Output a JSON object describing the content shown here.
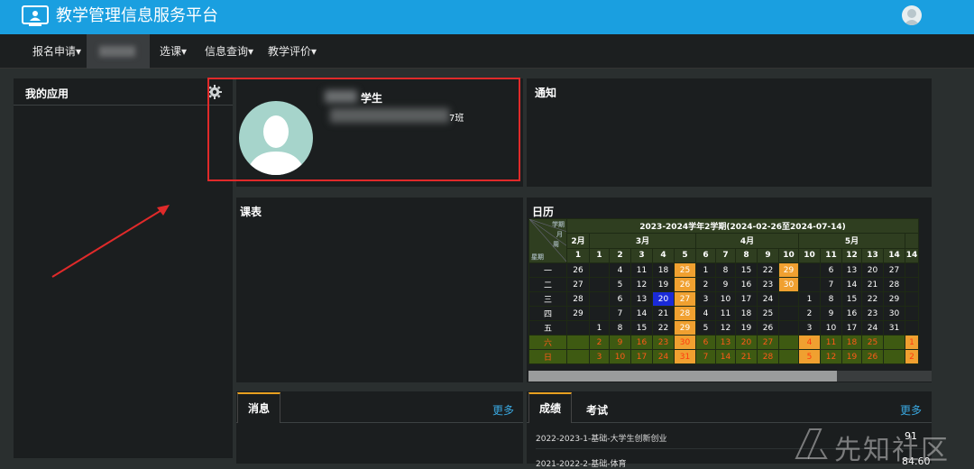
{
  "app": {
    "title": "教学管理信息服务平台"
  },
  "nav": {
    "items": [
      {
        "label": "报名申请▾"
      },
      {
        "label": "选课▾"
      },
      {
        "label": "信息查询▾"
      },
      {
        "label": "教学评价▾"
      }
    ]
  },
  "apps_panel": {
    "title": "我的应用"
  },
  "profile": {
    "role": "学生",
    "class_suffix": "7班"
  },
  "notice": {
    "title": "通知"
  },
  "schedule": {
    "title": "课表"
  },
  "calendar": {
    "title": "日历",
    "term": "2023-2024学年2学期(2024-02-26至2024-07-14)",
    "corner": {
      "top": "学期",
      "mid1": "月",
      "mid2": "周",
      "bottom": "星期"
    },
    "months": [
      "2月",
      "3月",
      "4月",
      "5月"
    ],
    "weeks": [
      "1",
      "1",
      "2",
      "3",
      "4",
      "5",
      "6",
      "7",
      "8",
      "9",
      "10",
      "10",
      "11",
      "12",
      "13",
      "14",
      "14"
    ],
    "day_labels": [
      "一",
      "二",
      "三",
      "四",
      "五",
      "六",
      "日"
    ],
    "rows": [
      [
        "26",
        "",
        "4",
        "11",
        "18",
        "25",
        "1",
        "8",
        "15",
        "22",
        "29",
        "",
        "6",
        "13",
        "20",
        "27",
        ""
      ],
      [
        "27",
        "",
        "5",
        "12",
        "19",
        "26",
        "2",
        "9",
        "16",
        "23",
        "30",
        "",
        "7",
        "14",
        "21",
        "28",
        ""
      ],
      [
        "28",
        "",
        "6",
        "13",
        "20",
        "27",
        "3",
        "10",
        "17",
        "24",
        "",
        "1",
        "8",
        "15",
        "22",
        "29",
        ""
      ],
      [
        "29",
        "",
        "7",
        "14",
        "21",
        "28",
        "4",
        "11",
        "18",
        "25",
        "",
        "2",
        "9",
        "16",
        "23",
        "30",
        ""
      ],
      [
        "",
        "1",
        "8",
        "15",
        "22",
        "29",
        "5",
        "12",
        "19",
        "26",
        "",
        "3",
        "10",
        "17",
        "24",
        "31",
        ""
      ],
      [
        "",
        "2",
        "9",
        "16",
        "23",
        "30",
        "6",
        "13",
        "20",
        "27",
        "",
        "4",
        "11",
        "18",
        "25",
        "",
        "1"
      ],
      [
        "",
        "3",
        "10",
        "17",
        "24",
        "31",
        "7",
        "14",
        "21",
        "28",
        "",
        "5",
        "12",
        "19",
        "26",
        "",
        "2"
      ]
    ]
  },
  "messages": {
    "tab_label": "消息",
    "more": "更多"
  },
  "grades": {
    "tab_grades": "成绩",
    "tab_exam": "考试",
    "more": "更多",
    "rows": [
      {
        "course": "2022-2023-1-基础-大学生创新创业",
        "score": "91"
      },
      {
        "course": "2021-2022-2-基础-体育",
        "score": "84.60"
      }
    ]
  },
  "watermark": {
    "text": "先知社区"
  },
  "colors": {
    "topbar": "#1a9fe0",
    "accent_tab": "#e8a020",
    "link": "#3aa8e0",
    "redbox": "#e02a2a"
  }
}
